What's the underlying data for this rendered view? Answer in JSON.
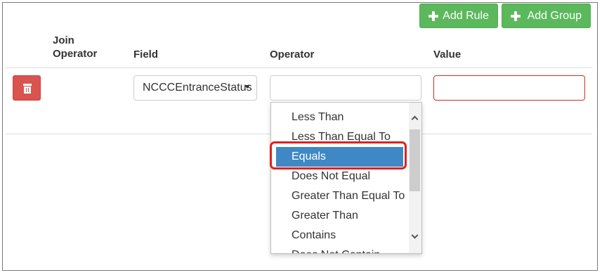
{
  "toolbar": {
    "add_rule_label": "Add Rule",
    "add_group_label": "Add Group"
  },
  "headers": {
    "join_operator": "Join Operator",
    "field": "Field",
    "operator": "Operator",
    "value": "Value"
  },
  "rule": {
    "field_value": "NCCCEntranceStatus",
    "operator_value": "",
    "value_value": ""
  },
  "operator_options": [
    {
      "label": "Less Than",
      "selected": false
    },
    {
      "label": "Less Than Equal To",
      "selected": false
    },
    {
      "label": "Equals",
      "selected": true
    },
    {
      "label": "Does Not Equal",
      "selected": false
    },
    {
      "label": "Greater Than Equal To",
      "selected": false
    },
    {
      "label": "Greater Than",
      "selected": false
    },
    {
      "label": "Contains",
      "selected": false
    },
    {
      "label": "Does Not Contain",
      "selected": false
    }
  ],
  "colors": {
    "success": "#5cb85c",
    "danger": "#d9534f",
    "selected_option": "#3f88c5",
    "highlight_box": "#e02020"
  },
  "icons": {
    "add_rule": "plus-icon",
    "add_group": "plus-icon",
    "delete_rule": "trash-icon",
    "field_dropdown": "caret-down-icon",
    "scroll_up": "chevron-up-icon",
    "scroll_down": "chevron-down-icon"
  }
}
